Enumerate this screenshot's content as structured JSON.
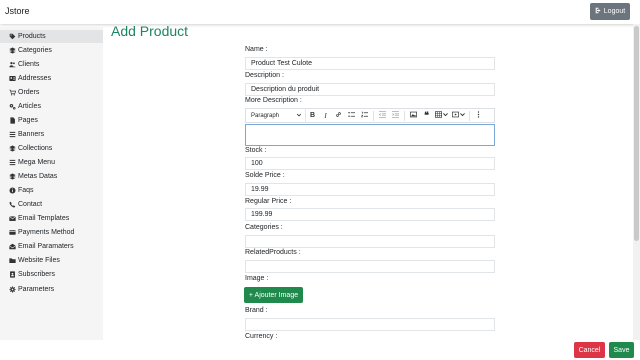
{
  "app": {
    "brand": "Jstore",
    "logout_label": "Logout"
  },
  "sidebar": {
    "items": [
      {
        "label": "Products",
        "icon": "tag-icon",
        "active": true
      },
      {
        "label": "Categories",
        "icon": "layers-icon"
      },
      {
        "label": "Clients",
        "icon": "users-icon"
      },
      {
        "label": "Addresses",
        "icon": "address-card-icon"
      },
      {
        "label": "Orders",
        "icon": "cart-icon"
      },
      {
        "label": "Articles",
        "icon": "gears-icon"
      },
      {
        "label": "Pages",
        "icon": "file-icon"
      },
      {
        "label": "Banners",
        "icon": "bars-icon"
      },
      {
        "label": "Collections",
        "icon": "layers-icon"
      },
      {
        "label": "Mega Menu",
        "icon": "list-icon"
      },
      {
        "label": "Metas Datas",
        "icon": "layers-icon"
      },
      {
        "label": "Faqs",
        "icon": "info-circle-icon"
      },
      {
        "label": "Contact",
        "icon": "phone-icon"
      },
      {
        "label": "Email Templates",
        "icon": "envelope-icon"
      },
      {
        "label": "Payments Method",
        "icon": "credit-card-icon"
      },
      {
        "label": "Email Paramaters",
        "icon": "envelope-open-icon"
      },
      {
        "label": "Website Files",
        "icon": "folder-icon"
      },
      {
        "label": "Subscribers",
        "icon": "address-book-icon"
      },
      {
        "label": "Parameters",
        "icon": "gear-icon"
      }
    ]
  },
  "page": {
    "title": "Add Product"
  },
  "form": {
    "name": {
      "label": "Name :",
      "value": "Product Test Culote"
    },
    "description": {
      "label": "Description :",
      "value": "Description du produit"
    },
    "more_description": {
      "label": "More Description :",
      "paragraph_label": "Paragraph"
    },
    "stock": {
      "label": "Stock :",
      "value": "100"
    },
    "solde_price": {
      "label": "Solde Price :",
      "value": "19.99"
    },
    "regular_price": {
      "label": "Regular Price :",
      "value": "199.99"
    },
    "categories": {
      "label": "Categories :",
      "value": ""
    },
    "related_products": {
      "label": "RelatedProducts :",
      "value": ""
    },
    "image": {
      "label": "Image :",
      "button_label": "+ Ajouter Image"
    },
    "brand": {
      "label": "Brand :",
      "value": ""
    },
    "currency": {
      "label": "Currency :"
    }
  },
  "footer": {
    "cancel_label": "Cancel",
    "save_label": "Save"
  },
  "colors": {
    "accent": "#1d8466",
    "success": "#1f8a4c",
    "danger": "#dc3545",
    "secondary": "#6c757d"
  }
}
